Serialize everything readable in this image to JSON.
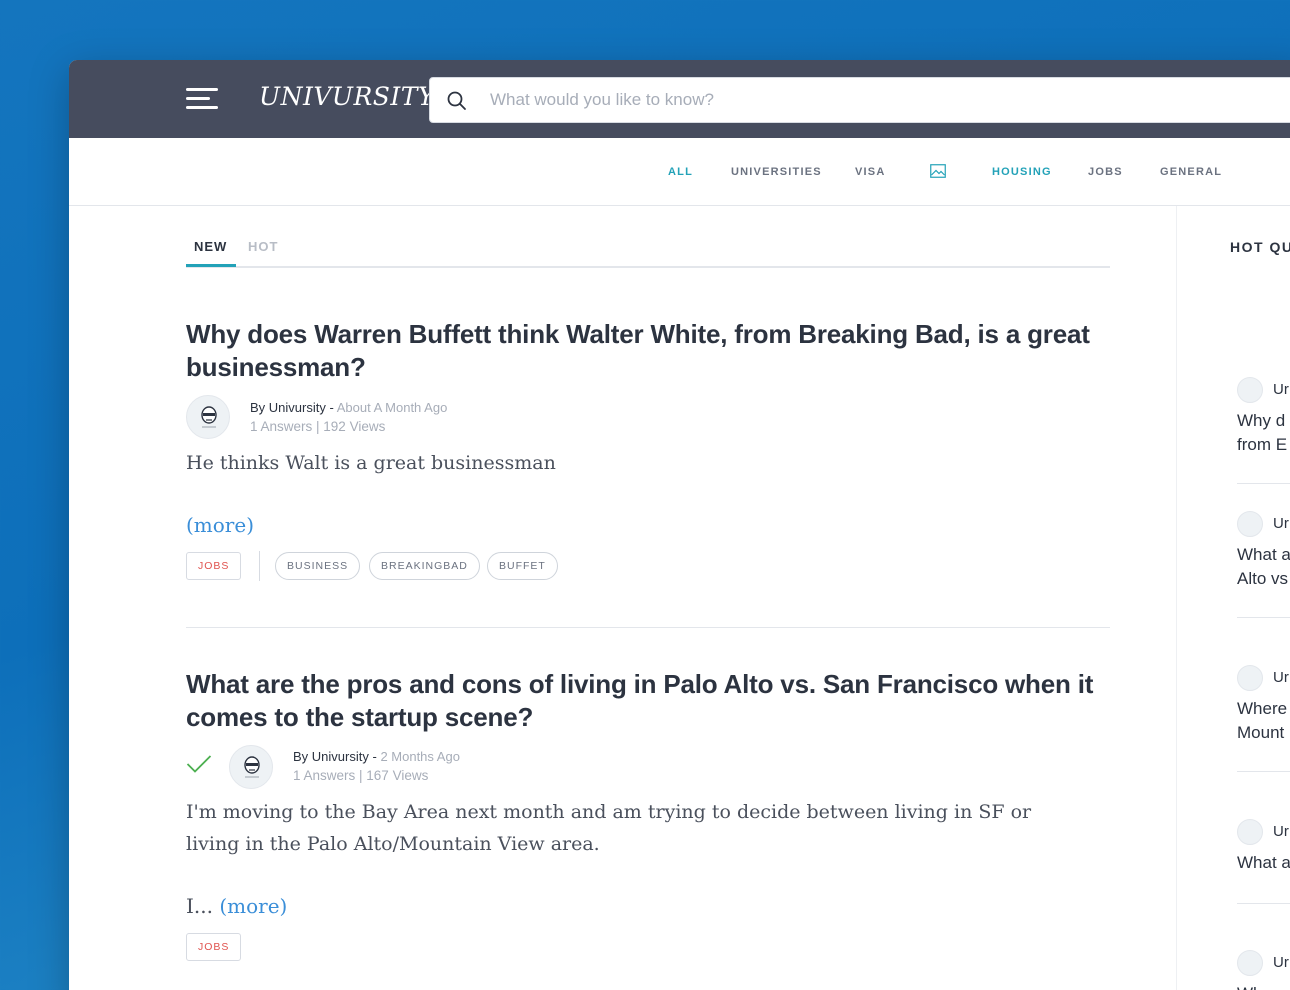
{
  "header": {
    "logo": "UNIVURSITY",
    "search_placeholder": "What would you like to know?"
  },
  "categories": [
    "ALL",
    "UNIVERSITIES",
    "VISA",
    "HOUSING",
    "JOBS",
    "GENERAL"
  ],
  "tabs": {
    "new": "NEW",
    "hot": "HOT"
  },
  "posts": [
    {
      "title": "Why does Warren Buffett think Walter White, from Breaking Bad, is a great businessman?",
      "by": "By",
      "author": "Univursity",
      "sep": " - ",
      "time": "About A Month Ago",
      "stats": "1 Answers | 192 Views",
      "excerpt": "He thinks Walt is a great businessman",
      "more": "(more)",
      "category": "JOBS",
      "tags": [
        "BUSINESS",
        "BREAKINGBAD",
        "BUFFET"
      ]
    },
    {
      "title": "What are the pros and cons of living in Palo Alto vs. San Francisco when it comes to the startup scene?",
      "by": "By",
      "author": "Univursity",
      "sep": " - ",
      "time": "2 Months Ago",
      "stats": "1 Answers | 167 Views",
      "excerpt": "I'm moving to the Bay Area next month and am trying to decide between living in SF or living in the Palo Alto/Mountain View area.",
      "more_prefix": "I...",
      "more": "(more)",
      "category": "JOBS"
    }
  ],
  "sidebar": {
    "title": "HOT QU",
    "items": [
      {
        "author": "Ur",
        "line1": "Why d",
        "line2": "from E"
      },
      {
        "author": "Ur",
        "line1": "What a",
        "line2": "Alto vs"
      },
      {
        "author": "Ur",
        "line1": "Where",
        "line2": "Mount"
      },
      {
        "author": "Ur",
        "line1": "What a",
        "line2": ""
      },
      {
        "author": "Ur",
        "line1": "Why s",
        "line2": ""
      }
    ]
  },
  "colors": {
    "topbar": "#464c5e",
    "accent": "#23a2b8",
    "link": "#3a8ed8",
    "category_tag": "#e0534f",
    "check": "#4caf50"
  }
}
